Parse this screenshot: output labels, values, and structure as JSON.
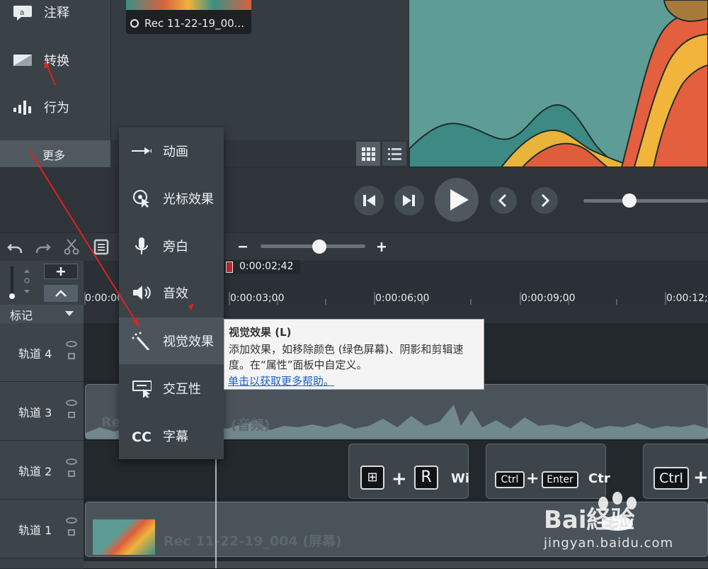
{
  "tools": [
    {
      "label": "注释",
      "icon": "annotation-icon"
    },
    {
      "label": "转换",
      "icon": "transition-icon"
    },
    {
      "label": "行为",
      "icon": "behavior-icon"
    }
  ],
  "more_label": "更多",
  "media_bin": {
    "clip_name": "Rec 11-22-19_00..."
  },
  "playhead_time": "0:00:02;42",
  "ruler_ticks": [
    "0:00:00",
    "0:00:03;00",
    "0:00:06;00",
    "0:00:09;00",
    "0:00:12;0"
  ],
  "marker_label": "标记",
  "tracks": [
    {
      "name": "轨道 4"
    },
    {
      "name": "轨道 3"
    },
    {
      "name": "轨道 2"
    },
    {
      "name": "轨道 1"
    }
  ],
  "track3_clip_label": "(音频)",
  "track3_clip_prefix": "Re",
  "track1_clip_label": "Rec 11-22-19_004 (屏幕)",
  "key_clips": [
    {
      "keys": [
        "⊞",
        "+",
        "R"
      ],
      "text": "Wi"
    },
    {
      "keys": [
        "Ctrl",
        "+",
        "Enter"
      ],
      "text": "Ctr"
    },
    {
      "keys": [
        "Ctrl",
        "+"
      ],
      "text": ""
    }
  ],
  "menu": {
    "items": [
      {
        "label": "动画",
        "icon": "animation-icon"
      },
      {
        "label": "光标效果",
        "icon": "cursor-effects-icon"
      },
      {
        "label": "旁白",
        "icon": "microphone-icon"
      },
      {
        "label": "音效",
        "icon": "speaker-icon"
      },
      {
        "label": "视觉效果",
        "icon": "magic-wand-icon",
        "selected": true
      },
      {
        "label": "交互性",
        "icon": "interactivity-icon"
      },
      {
        "label": "字幕",
        "icon": "captions-icon"
      }
    ]
  },
  "tooltip": {
    "title": "视觉效果 (L)",
    "body": "添加效果，如移除颜色 (绿色屏幕)、阴影和剪辑速度。在“属性”面板中自定义。",
    "link": "单击以获取更多帮助。"
  },
  "watermark": {
    "brand": "Bai経验",
    "site": "jingyan.baidu.com"
  },
  "colors": {
    "accent_red": "#e02020",
    "tooltip_link": "#1a62c8",
    "playhead": "#c0282b"
  }
}
